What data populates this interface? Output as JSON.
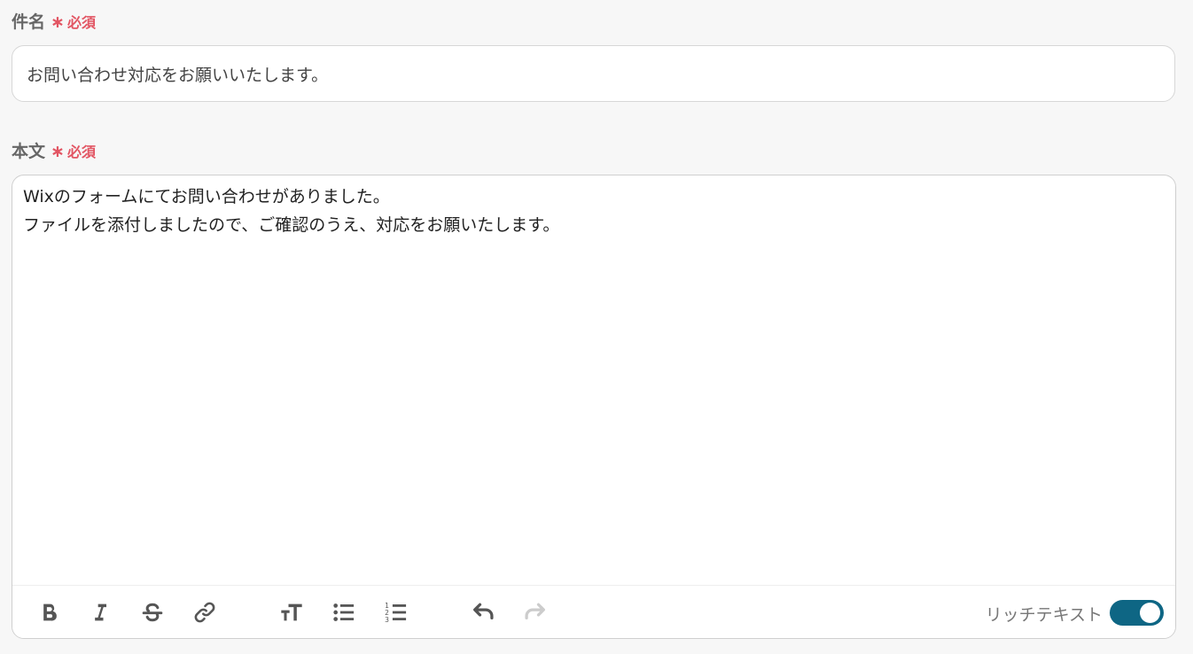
{
  "subject": {
    "label": "件名",
    "required_mark": "∗",
    "required_text": "必須",
    "value": "お問い合わせ対応をお願いいたします。"
  },
  "body": {
    "label": "本文",
    "required_mark": "∗",
    "required_text": "必須",
    "lines": [
      "Wixのフォームにてお問い合わせがありました。",
      "ファイルを添付しましたので、ご確認のうえ、対応をお願いたします。"
    ]
  },
  "toolbar": {
    "buttons": [
      {
        "name": "bold-icon"
      },
      {
        "name": "italic-icon"
      },
      {
        "name": "strikethrough-icon"
      },
      {
        "name": "link-icon"
      },
      {
        "name": "font-size-icon"
      },
      {
        "name": "bullet-list-icon"
      },
      {
        "name": "numbered-list-icon"
      },
      {
        "name": "undo-icon"
      },
      {
        "name": "redo-icon"
      }
    ],
    "rich_text_label": "リッチテキスト",
    "rich_text_enabled": true
  },
  "colors": {
    "required": "#e25563",
    "toggle_on": "#0e6684",
    "icon": "#555555",
    "icon_disabled": "#cccccc"
  }
}
